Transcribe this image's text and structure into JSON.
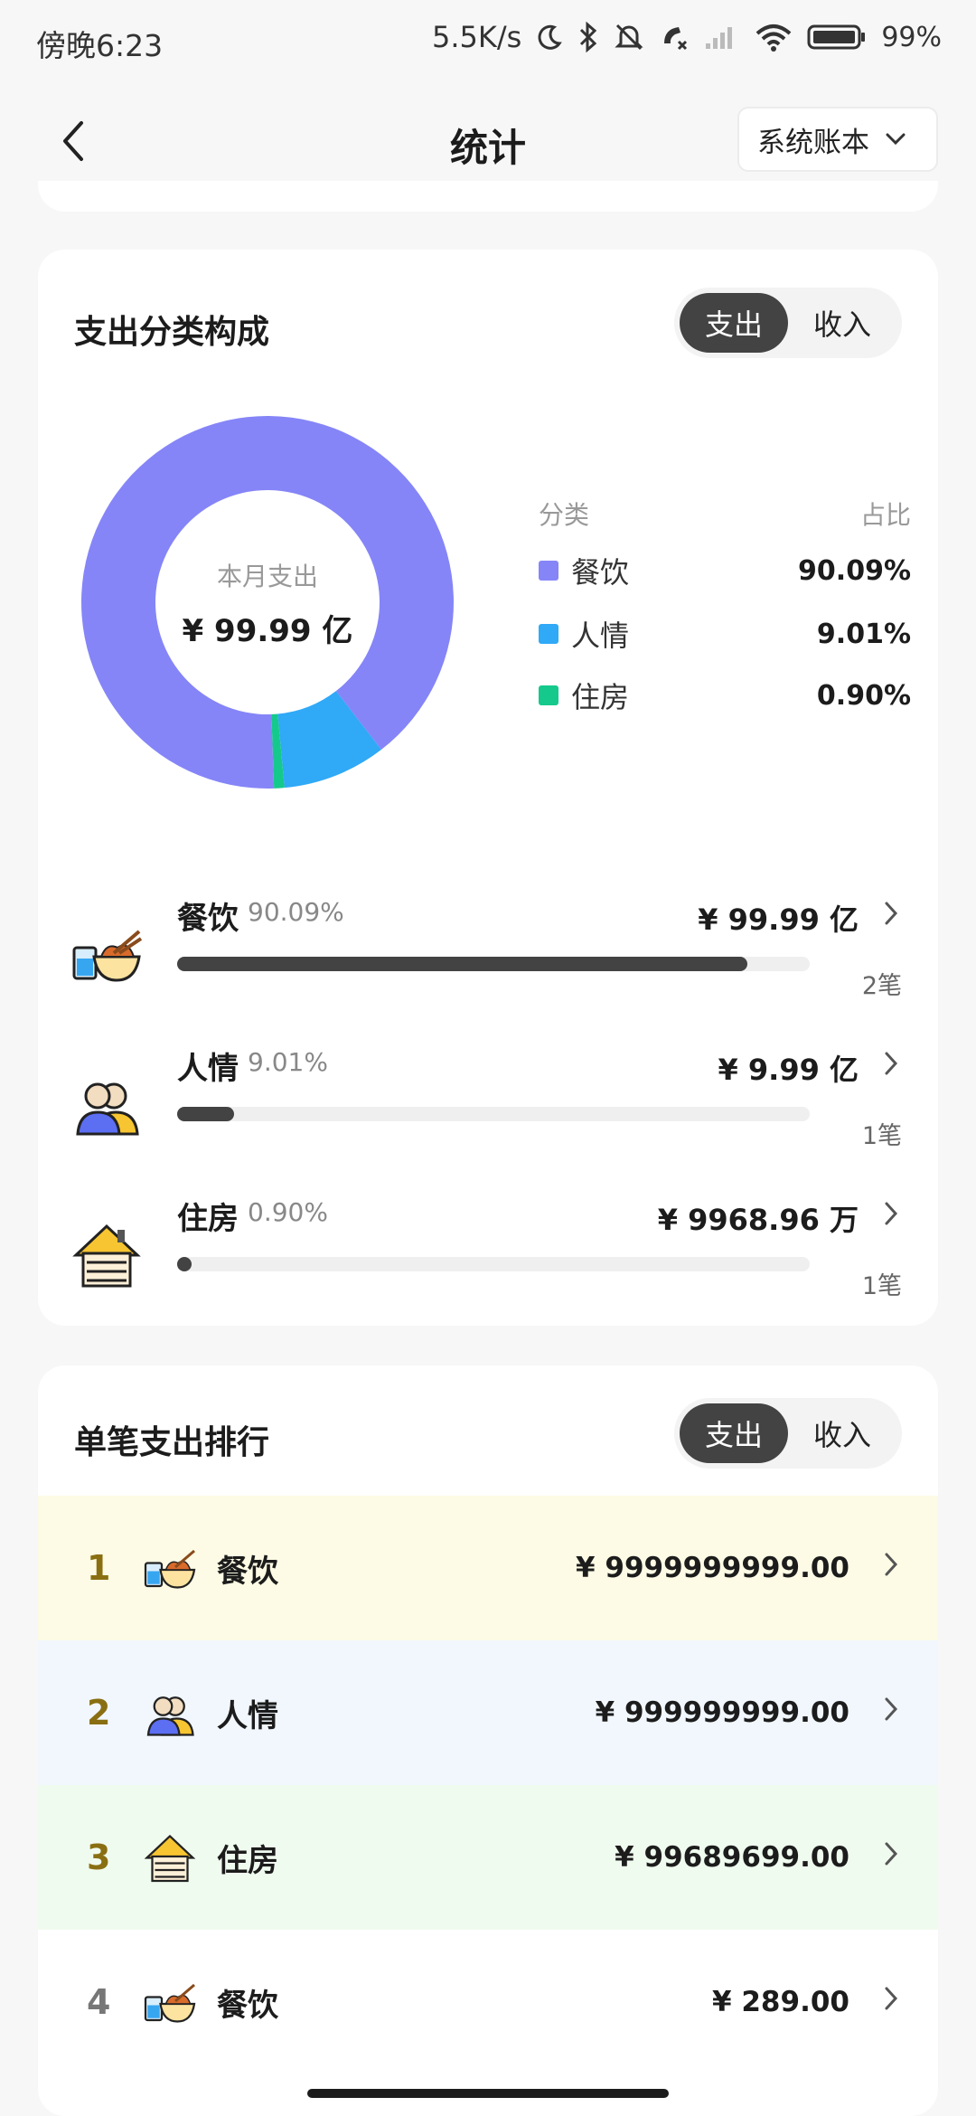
{
  "status_bar": {
    "time": "傍晚6:23",
    "network_speed": "5.5K/s",
    "battery": "99%"
  },
  "nav": {
    "title": "统计",
    "book_select": "系统账本"
  },
  "category_card": {
    "title": "支出分类构成",
    "toggle": {
      "expense": "支出",
      "income": "收入",
      "active": "expense"
    },
    "donut_label": "本月支出",
    "donut_value": "¥ 99.99 亿",
    "legend_head": {
      "category": "分类",
      "ratio": "占比"
    },
    "legend": [
      {
        "name": "餐饮",
        "pct": "90.09%",
        "color": "#8585f8"
      },
      {
        "name": "人情",
        "pct": "9.01%",
        "color": "#30a9f7"
      },
      {
        "name": "住房",
        "pct": "0.90%",
        "color": "#15c98c"
      }
    ],
    "items": [
      {
        "name": "餐饮",
        "pct": "90.09%",
        "amount": "¥ 99.99 亿",
        "count": "2笔",
        "fill": 0.9009,
        "icon": "food-icon"
      },
      {
        "name": "人情",
        "pct": "9.01%",
        "amount": "¥ 9.99 亿",
        "count": "1笔",
        "fill": 0.0901,
        "icon": "people-icon"
      },
      {
        "name": "住房",
        "pct": "0.90%",
        "amount": "¥ 9968.96 万",
        "count": "1笔",
        "fill": 0.009,
        "icon": "house-icon"
      }
    ]
  },
  "chart_data": {
    "type": "pie",
    "categories": [
      "餐饮",
      "人情",
      "住房"
    ],
    "values": [
      90.09,
      9.01,
      0.9
    ],
    "colors": [
      "#8585f8",
      "#30a9f7",
      "#15c98c"
    ]
  },
  "ranking_card": {
    "title": "单笔支出排行",
    "toggle": {
      "expense": "支出",
      "income": "收入",
      "active": "expense"
    },
    "items": [
      {
        "rank": "1",
        "name": "餐饮",
        "amount": "¥ 9999999999.00",
        "bg": "#fdfbe5",
        "num_color": "#8a6f12",
        "icon": "food-icon"
      },
      {
        "rank": "2",
        "name": "人情",
        "amount": "¥ 999999999.00",
        "bg": "#f1f7fd",
        "num_color": "#8a6f12",
        "icon": "people-icon"
      },
      {
        "rank": "3",
        "name": "住房",
        "amount": "¥ 99689699.00",
        "bg": "#f0fbef",
        "num_color": "#8a6f12",
        "icon": "house-icon"
      },
      {
        "rank": "4",
        "name": "餐饮",
        "amount": "¥ 289.00",
        "bg": "#ffffff",
        "num_color": "#777777",
        "icon": "food-icon"
      }
    ]
  }
}
